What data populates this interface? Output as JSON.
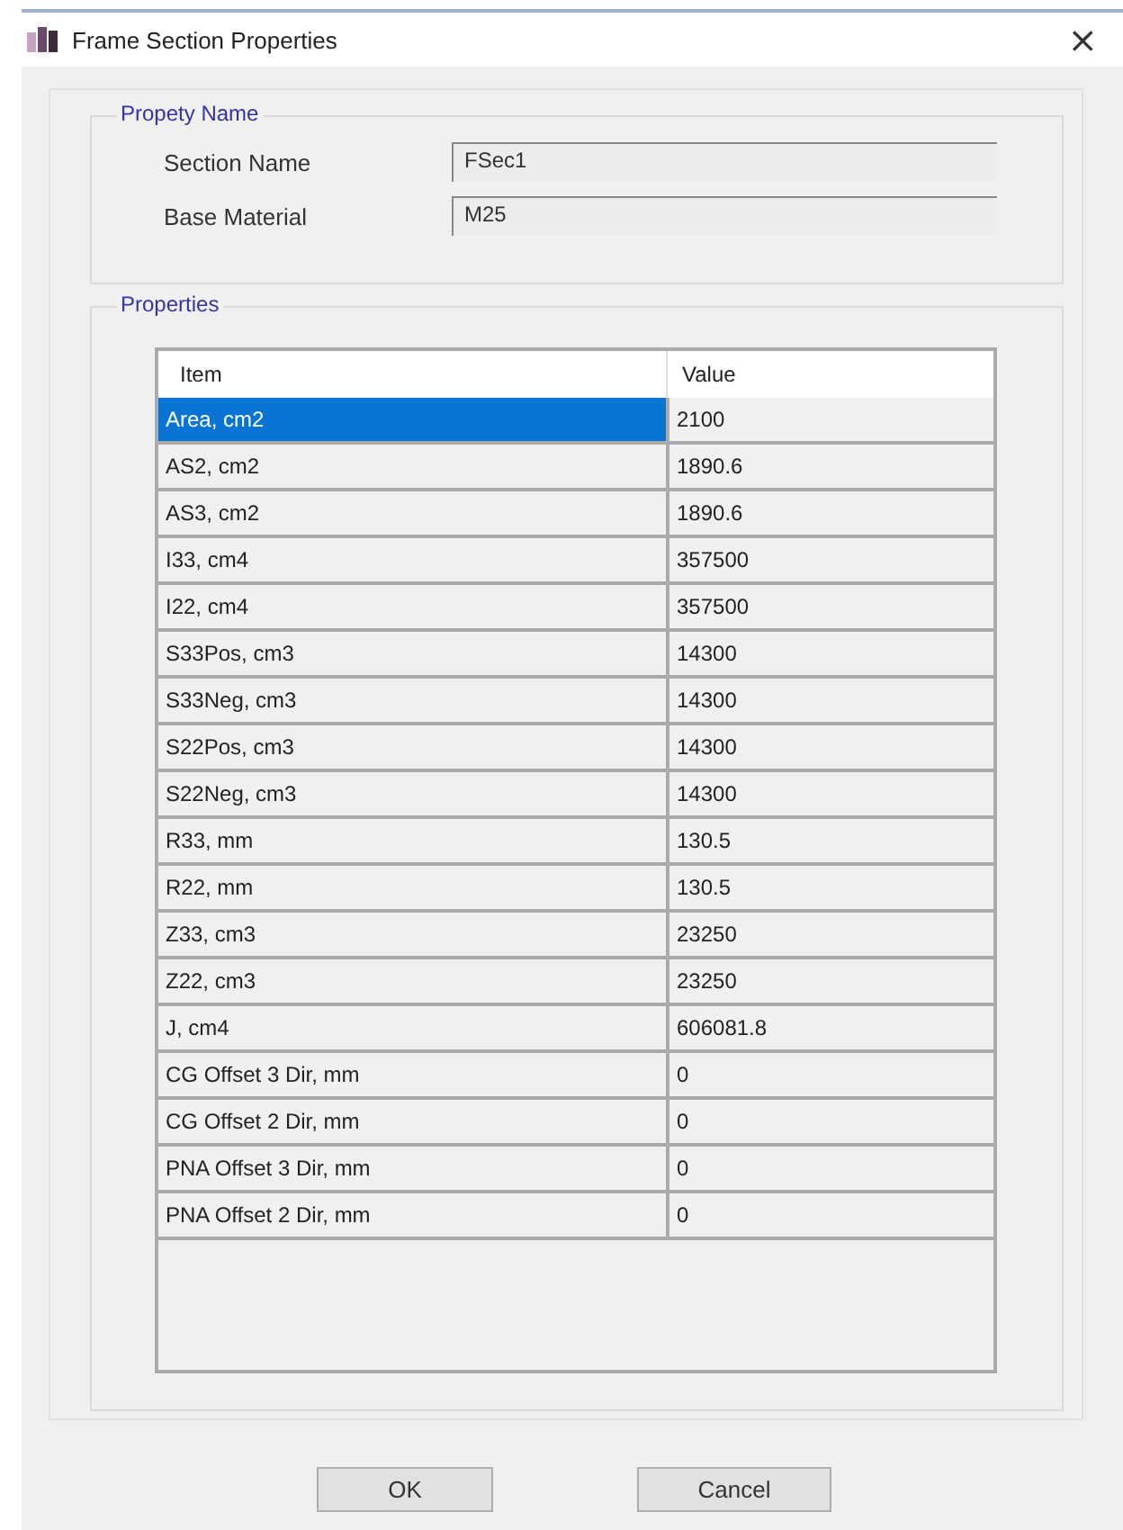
{
  "window": {
    "title": "Frame Section Properties",
    "close": "×"
  },
  "property_name": {
    "title": "Propety Name",
    "fields": [
      {
        "label": "Section Name",
        "value": "FSec1"
      },
      {
        "label": "Base Material",
        "value": "M25"
      }
    ]
  },
  "properties": {
    "title": "Properties",
    "table": {
      "columns": [
        "Item",
        "Value"
      ],
      "rows": [
        {
          "item": "Area, cm2",
          "value": "2100",
          "selected": true
        },
        {
          "item": "AS2, cm2",
          "value": "1890.6",
          "selected": false
        },
        {
          "item": "AS3, cm2",
          "value": "1890.6",
          "selected": false
        },
        {
          "item": "I33, cm4",
          "value": "357500",
          "selected": false
        },
        {
          "item": "I22, cm4",
          "value": "357500",
          "selected": false
        },
        {
          "item": "S33Pos, cm3",
          "value": "14300",
          "selected": false
        },
        {
          "item": "S33Neg, cm3",
          "value": "14300",
          "selected": false
        },
        {
          "item": "S22Pos, cm3",
          "value": "14300",
          "selected": false
        },
        {
          "item": "S22Neg, cm3",
          "value": "14300",
          "selected": false
        },
        {
          "item": "R33, mm",
          "value": "130.5",
          "selected": false
        },
        {
          "item": "R22, mm",
          "value": "130.5",
          "selected": false
        },
        {
          "item": "Z33, cm3",
          "value": "23250",
          "selected": false
        },
        {
          "item": "Z22, cm3",
          "value": "23250",
          "selected": false
        },
        {
          "item": "J, cm4",
          "value": "606081.8",
          "selected": false
        },
        {
          "item": "CG Offset 3 Dir, mm",
          "value": "0",
          "selected": false
        },
        {
          "item": "CG Offset 2 Dir, mm",
          "value": "0",
          "selected": false
        },
        {
          "item": "PNA Offset 3 Dir, mm",
          "value": "0",
          "selected": false
        },
        {
          "item": "PNA Offset 2 Dir, mm",
          "value": "0",
          "selected": false
        }
      ]
    }
  },
  "buttons": [
    "OK",
    "Cancel"
  ]
}
